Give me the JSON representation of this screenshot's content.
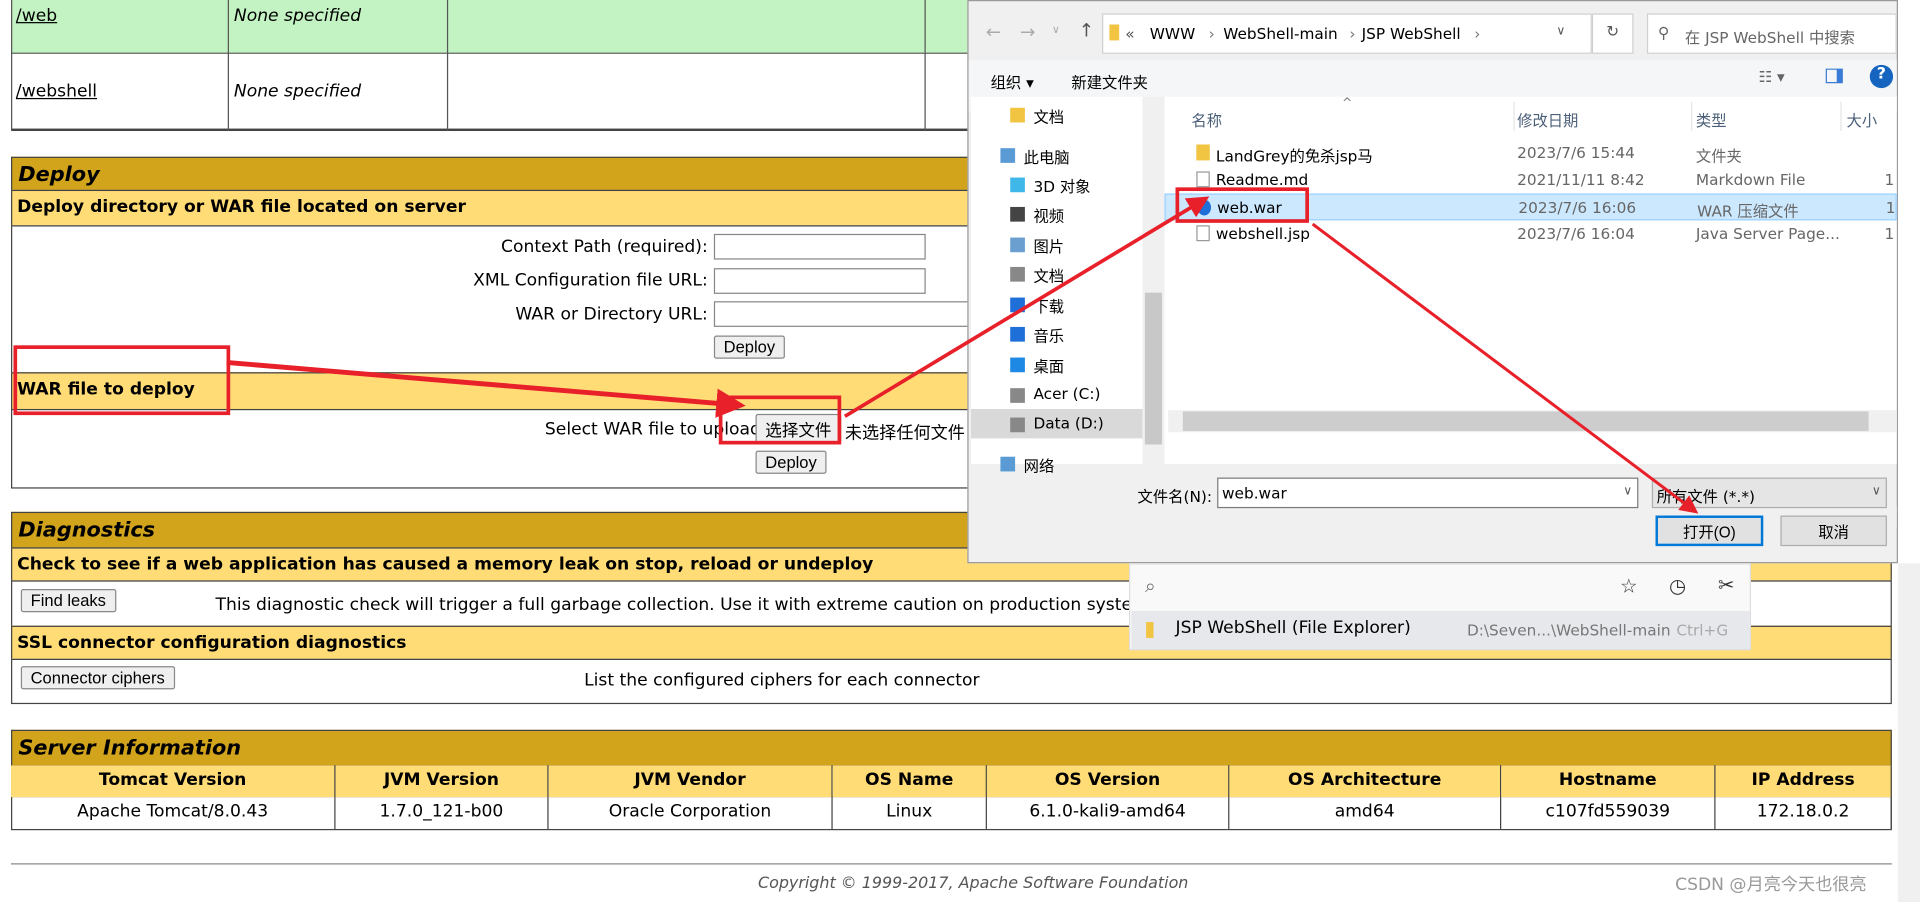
{
  "apps": [
    {
      "path": "/web",
      "version": "None specified"
    },
    {
      "path": "/webshell",
      "version": "None specified"
    }
  ],
  "deploy": {
    "title": "Deploy",
    "server_sub": "Deploy directory or WAR file located on server",
    "context_label": "Context Path (required):",
    "xml_label": "XML Configuration file URL:",
    "war_url_label": "WAR or Directory URL:",
    "deploy_btn": "Deploy",
    "war_sub": "WAR file to deploy",
    "select_label": "Select WAR file to upload",
    "choose_btn": "选择文件",
    "no_file": "未选择任何文件",
    "deploy_btn2": "Deploy"
  },
  "diagnostics": {
    "title": "Diagnostics",
    "leak_sub": "Check to see if a web application has caused a memory leak on stop, reload or undeploy",
    "find_leaks": "Find leaks",
    "leak_desc": "This diagnostic check will trigger a full garbage collection. Use it with extreme caution on production systems.",
    "ssl_sub": "SSL connector configuration diagnostics",
    "ciphers_btn": "Connector ciphers",
    "ciphers_desc": "List the configured ciphers for each connector"
  },
  "server": {
    "title": "Server Information",
    "headers": [
      "Tomcat Version",
      "JVM Version",
      "JVM Vendor",
      "OS Name",
      "OS Version",
      "OS Architecture",
      "Hostname",
      "IP Address"
    ],
    "values": [
      "Apache Tomcat/8.0.43",
      "1.7.0_121-b00",
      "Oracle Corporation",
      "Linux",
      "6.1.0-kali9-amd64",
      "amd64",
      "c107fd559039",
      "172.18.0.2"
    ]
  },
  "footer": {
    "copyright": "Copyright © 1999-2017, Apache Software Foundation",
    "watermark": "CSDN @月亮今天也很亮"
  },
  "dialog": {
    "breadcrumb": [
      "«",
      "WWW",
      "WebShell-main",
      "JSP WebShell"
    ],
    "search_placeholder": "在 JSP WebShell 中搜索",
    "organize": "组织 ▾",
    "new_folder": "新建文件夹",
    "nav": [
      "文档",
      "此电脑",
      "3D 对象",
      "视频",
      "图片",
      "文档",
      "下载",
      "音乐",
      "桌面",
      "Acer (C:)",
      "Data (D:)",
      "网络"
    ],
    "columns": [
      "名称",
      "修改日期",
      "类型",
      "大小"
    ],
    "files": [
      {
        "name": "LandGrey的免杀jsp马",
        "date": "2023/7/6 15:44",
        "type": "文件夹",
        "size": ""
      },
      {
        "name": "Readme.md",
        "date": "2021/11/11 8:42",
        "type": "Markdown File",
        "size": "1"
      },
      {
        "name": "web.war",
        "date": "2023/7/6 16:06",
        "type": "WAR 压缩文件",
        "size": "1",
        "selected": true
      },
      {
        "name": "webshell.jsp",
        "date": "2023/7/6 16:04",
        "type": "Java Server Page...",
        "size": "1"
      }
    ],
    "filename_label": "文件名(N):",
    "filename_value": "web.war",
    "filter": "所有文件 (*.*)",
    "open_btn": "打开(O)",
    "cancel_btn": "取消"
  },
  "popup": {
    "item": "JSP WebShell (File Explorer)",
    "path": "D:\\Seven...\\WebShell-main",
    "shortcut": "Ctrl+G"
  },
  "colors": {
    "header": "#d2a41c",
    "subheader": "#ffdc75",
    "app_row": "#c3f3c3",
    "annotation": "#e8202a",
    "selection": "#cce8ff"
  }
}
